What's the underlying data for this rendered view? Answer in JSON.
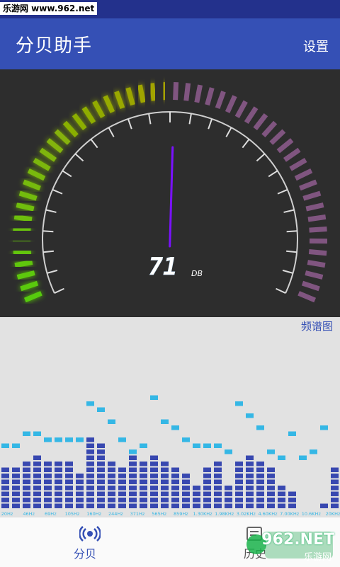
{
  "status_bar": {
    "watermark": "乐游网 www.962.net"
  },
  "app_bar": {
    "title": "分贝助手",
    "settings_label": "设置"
  },
  "meter": {
    "value": 71,
    "unit": "DB",
    "min": 0,
    "max": 140,
    "colors": {
      "low": "#55cc11",
      "mid": "#a8a000",
      "high": "#8a5a8a",
      "needle": "#7a11ff",
      "readout": "#ffffff"
    }
  },
  "spectrum": {
    "title": "频谱图",
    "bar_color": "#3848b0",
    "peak_color": "#35b7e5",
    "max_level": 17,
    "freq_labels": [
      "20Hz",
      "46Hz",
      "69Hz",
      "105Hz",
      "160Hz",
      "244Hz",
      "371Hz",
      "565Hz",
      "859Hz",
      "1.30KHz",
      "1.98KHz",
      "3.02KHz",
      "4.60KHz",
      "7.00KHz",
      "10.6KHz",
      "20KHz"
    ],
    "levels": [
      7,
      7,
      8,
      9,
      8,
      8,
      8,
      6,
      12,
      11,
      8,
      7,
      9,
      8,
      9,
      8,
      7,
      6,
      4,
      7,
      8,
      4,
      8,
      9,
      8,
      7,
      4,
      3,
      0,
      0,
      1,
      7
    ],
    "peaks": [
      10,
      10,
      12,
      12,
      11,
      11,
      11,
      11,
      17,
      16,
      14,
      11,
      9,
      10,
      18,
      14,
      13,
      11,
      10,
      10,
      10,
      9,
      17,
      15,
      13,
      9,
      8,
      12,
      8,
      9,
      13
    ]
  },
  "bottom_nav": {
    "items": [
      {
        "label": "分贝",
        "icon": "sound-wave-icon"
      },
      {
        "label": "历史",
        "icon": "history-icon"
      }
    ]
  },
  "watermark_logo": {
    "text": "962.NET",
    "sub": "乐游网"
  }
}
